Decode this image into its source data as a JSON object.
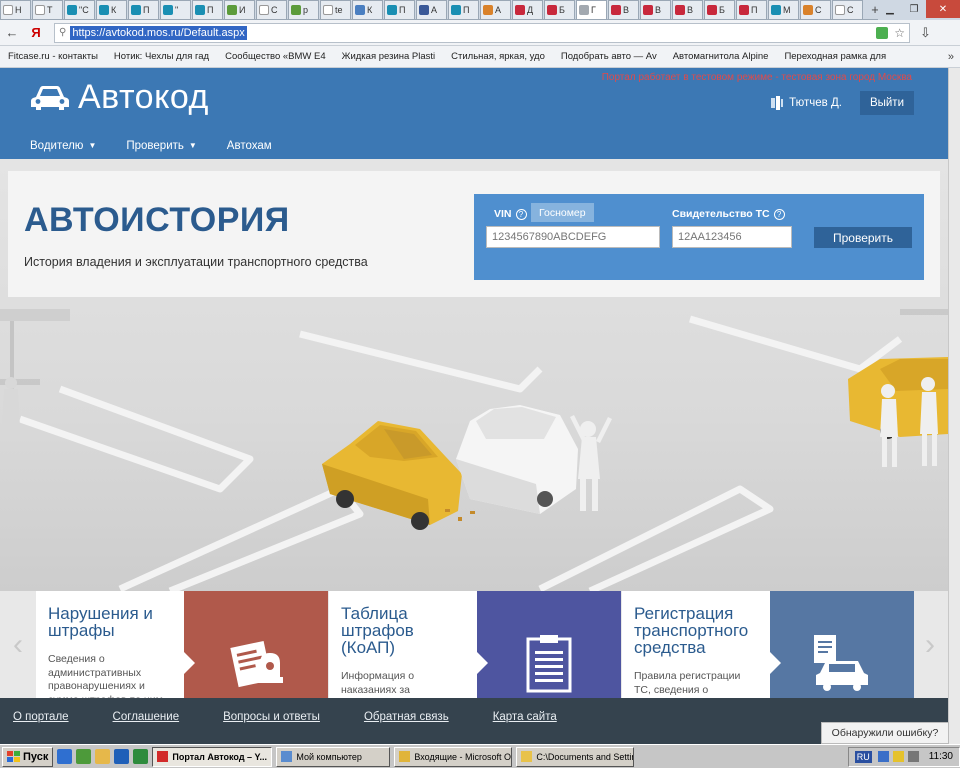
{
  "browser": {
    "tabs": [
      {
        "label": "Н",
        "fav": "doc"
      },
      {
        "label": "Т",
        "fav": "doc"
      },
      {
        "label": "\"С",
        "fav": "teal"
      },
      {
        "label": "К",
        "fav": "teal"
      },
      {
        "label": "П",
        "fav": "teal"
      },
      {
        "label": "\"",
        "fav": "teal"
      },
      {
        "label": "П",
        "fav": "teal"
      },
      {
        "label": "И",
        "fav": "green"
      },
      {
        "label": "С",
        "fav": "doc"
      },
      {
        "label": "р",
        "fav": "green"
      },
      {
        "label": "te",
        "fav": "doc"
      },
      {
        "label": "К",
        "fav": "blue"
      },
      {
        "label": "П",
        "fav": "teal"
      },
      {
        "label": "А",
        "fav": "fb"
      },
      {
        "label": "П",
        "fav": "teal"
      },
      {
        "label": "А",
        "fav": "orange"
      },
      {
        "label": "Д",
        "fav": "red"
      },
      {
        "label": "Б",
        "fav": "red"
      },
      {
        "label": "Г",
        "fav": "grey",
        "active": true
      },
      {
        "label": "В",
        "fav": "red"
      },
      {
        "label": "В",
        "fav": "red"
      },
      {
        "label": "В",
        "fav": "red"
      },
      {
        "label": "Б",
        "fav": "red"
      },
      {
        "label": "П",
        "fav": "red"
      },
      {
        "label": "М",
        "fav": "teal"
      },
      {
        "label": "С",
        "fav": "orange"
      },
      {
        "label": "С",
        "fav": "doc"
      }
    ],
    "new_tab": "+",
    "back_icon": "←",
    "yandex_icon": "Я",
    "url": "https://avtokod.mos.ru/Default.aspx",
    "star_icon": "☆",
    "download_icon": "⇩",
    "bookmarks": [
      "Fitcase.ru - контакты",
      "Нотик: Чехлы для гад",
      "Сообщество «BMW E4",
      "Жидкая резина Plasti",
      "Стильная, яркая, удо",
      "Подобрать авто — Av",
      "Автомагнитола Alpine",
      "Переходная рамка для"
    ],
    "bookmarks_more": "»"
  },
  "site": {
    "logo_text": "Автокод",
    "test_note": "Портал работает в тестовом режиме - тестовая зона город Москва",
    "user_name": "Тютчев Д.",
    "logout": "Выйти",
    "nav": [
      {
        "label": "Водителю",
        "caret": "▼"
      },
      {
        "label": "Проверить",
        "caret": "▼"
      },
      {
        "label": "Автохам",
        "caret": ""
      }
    ]
  },
  "hero": {
    "title": "АВТОИСТОРИЯ",
    "subtitle": "История владения и эксплуатации транспортного средства",
    "search": {
      "vin_label": "VIN",
      "help": "?",
      "tab_gosnomer": "Госномер",
      "vin_placeholder": "1234567890ABCDEFG",
      "sts_label": "Свидетельство ТС",
      "sts_placeholder": "12АА123456",
      "button": "Проверить"
    }
  },
  "tiles": {
    "prev": "‹",
    "next": "›",
    "items": [
      {
        "title": "Нарушения и штрафы",
        "desc": "Сведения о административных правонарушениях и сумме штрафов по ним",
        "icon": "fine-document-icon"
      },
      {
        "title": "Таблица штрафов (КоАП)",
        "desc": "Информация о наказаниях за административные правонарушения",
        "icon": "clipboard-icon"
      },
      {
        "title": "Регистрация транспортного средства",
        "desc": "Правила регистрации ТС, сведения о регистрационных действиях",
        "icon": "car-document-icon"
      }
    ]
  },
  "footer": {
    "links": [
      "О портале",
      "Соглашение",
      "Вопросы и ответы",
      "Обратная связь",
      "Карта сайта"
    ],
    "report_error": "Обнаружили ошибку?"
  },
  "taskbar": {
    "start": "Пуск",
    "tasks": [
      {
        "label": "Портал Автокод – Y...",
        "active": true,
        "color": "#d22a2a"
      },
      {
        "label": "Мой компьютер",
        "active": false,
        "color": "#5a8ccf"
      },
      {
        "label": "Входящие - Microsoft O...",
        "active": false,
        "color": "#e0b43a"
      },
      {
        "label": "C:\\Documents and Settin...",
        "active": false,
        "color": "#e8c24a"
      }
    ],
    "lang": "RU",
    "clock": "11:30"
  },
  "colors": {
    "header_blue": "#3c78b4",
    "title_blue": "#2b5b8e",
    "search_blue": "#4f8fcf",
    "button_dark_blue": "#2f6399",
    "tile_brown": "#b0594b",
    "tile_indigo": "#4e55a0",
    "tile_slate": "#5677a3",
    "footer_dark": "#35434e",
    "taxi_yellow": "#e8b832",
    "test_note_red": "#e14a4a"
  }
}
